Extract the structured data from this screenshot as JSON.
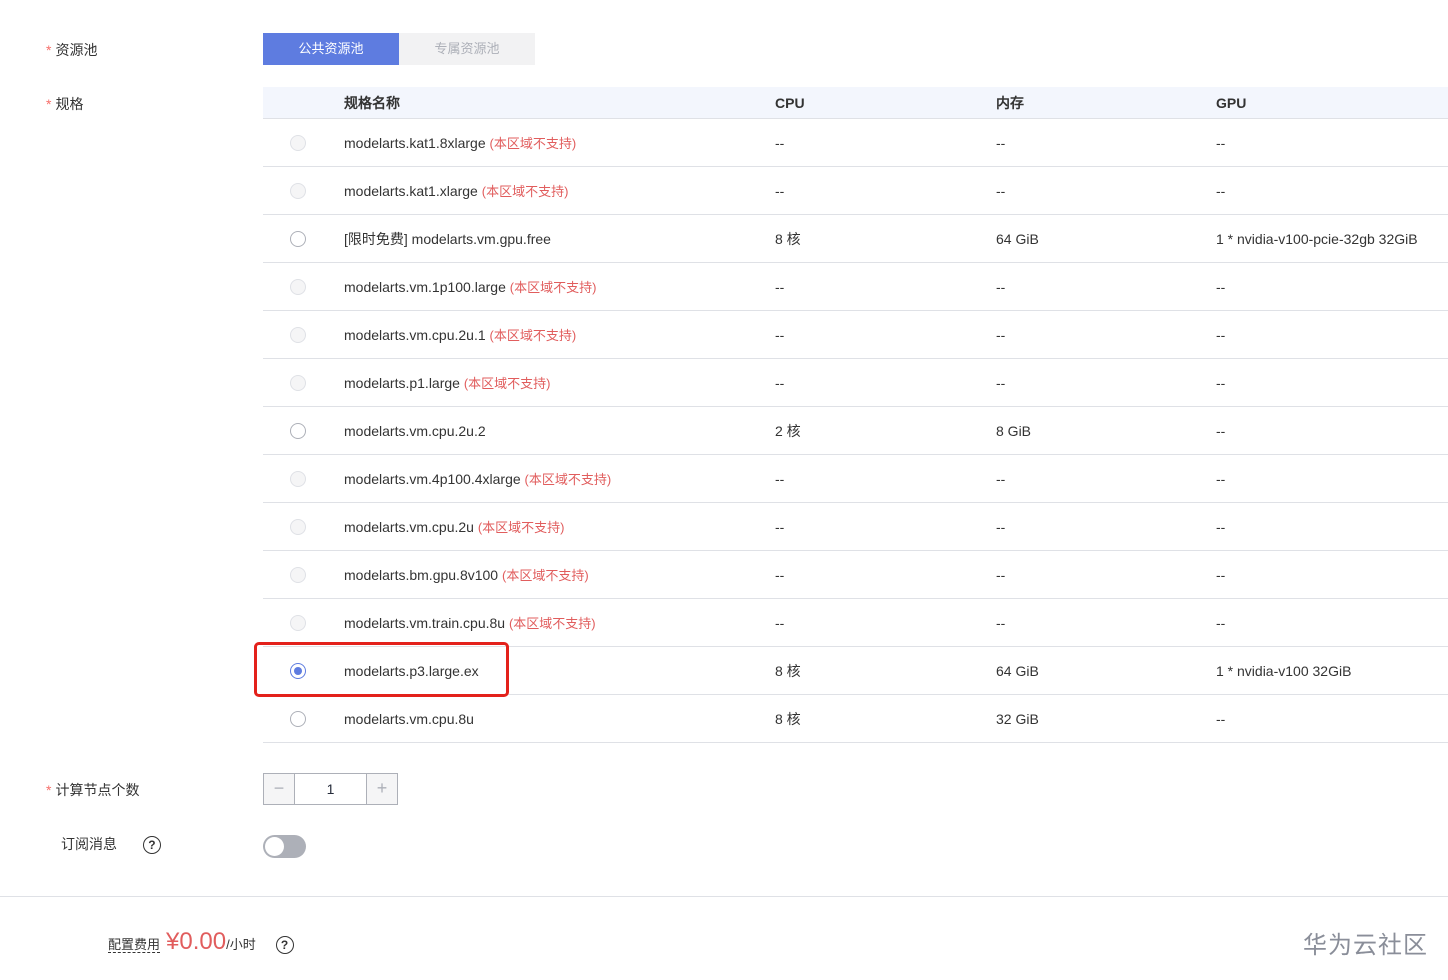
{
  "resource_pool": {
    "label": "资源池",
    "options": [
      "公共资源池",
      "专属资源池"
    ],
    "selected": "公共资源池"
  },
  "spec": {
    "label": "规格",
    "headers": [
      "规格名称",
      "CPU",
      "内存",
      "GPU"
    ],
    "rows": [
      {
        "name": "modelarts.kat1.8xlarge",
        "note": "(本区域不支持)",
        "cpu": "--",
        "mem": "--",
        "gpu": "--",
        "state": "disabled"
      },
      {
        "name": "modelarts.kat1.xlarge",
        "note": "(本区域不支持)",
        "cpu": "--",
        "mem": "--",
        "gpu": "--",
        "state": "disabled"
      },
      {
        "name": "[限时免费] modelarts.vm.gpu.free",
        "note": "",
        "cpu": "8 核",
        "mem": "64 GiB",
        "gpu": "1 * nvidia-v100-pcie-32gb 32GiB",
        "state": "enabled"
      },
      {
        "name": "modelarts.vm.1p100.large",
        "note": "(本区域不支持)",
        "cpu": "--",
        "mem": "--",
        "gpu": "--",
        "state": "disabled"
      },
      {
        "name": "modelarts.vm.cpu.2u.1",
        "note": "(本区域不支持)",
        "cpu": "--",
        "mem": "--",
        "gpu": "--",
        "state": "disabled"
      },
      {
        "name": "modelarts.p1.large",
        "note": "(本区域不支持)",
        "cpu": "--",
        "mem": "--",
        "gpu": "--",
        "state": "disabled"
      },
      {
        "name": "modelarts.vm.cpu.2u.2",
        "note": "",
        "cpu": "2 核",
        "mem": "8 GiB",
        "gpu": "--",
        "state": "enabled"
      },
      {
        "name": "modelarts.vm.4p100.4xlarge",
        "note": "(本区域不支持)",
        "cpu": "--",
        "mem": "--",
        "gpu": "--",
        "state": "disabled"
      },
      {
        "name": "modelarts.vm.cpu.2u",
        "note": "(本区域不支持)",
        "cpu": "--",
        "mem": "--",
        "gpu": "--",
        "state": "disabled"
      },
      {
        "name": "modelarts.bm.gpu.8v100",
        "note": "(本区域不支持)",
        "cpu": "--",
        "mem": "--",
        "gpu": "--",
        "state": "disabled"
      },
      {
        "name": "modelarts.vm.train.cpu.8u",
        "note": "(本区域不支持)",
        "cpu": "--",
        "mem": "--",
        "gpu": "--",
        "state": "disabled"
      },
      {
        "name": "modelarts.p3.large.ex",
        "note": "",
        "cpu": "8 核",
        "mem": "64 GiB",
        "gpu": "1 * nvidia-v100 32GiB",
        "state": "checked"
      },
      {
        "name": "modelarts.vm.cpu.8u",
        "note": "",
        "cpu": "8 核",
        "mem": "32 GiB",
        "gpu": "--",
        "state": "enabled"
      }
    ]
  },
  "node_count": {
    "label": "计算节点个数",
    "value": "1",
    "minus": "−",
    "plus": "+"
  },
  "subscribe": {
    "label": "订阅消息",
    "help": "?",
    "enabled": false
  },
  "footer": {
    "fee_label": "配置费用",
    "price": "¥0.00",
    "unit": "/小时",
    "help": "?",
    "watermark": "华为云社区"
  },
  "colors": {
    "accent": "#5e7ce0",
    "required": "#f66f6a",
    "warning": "#e15d5d",
    "highlight": "#e3211b"
  }
}
